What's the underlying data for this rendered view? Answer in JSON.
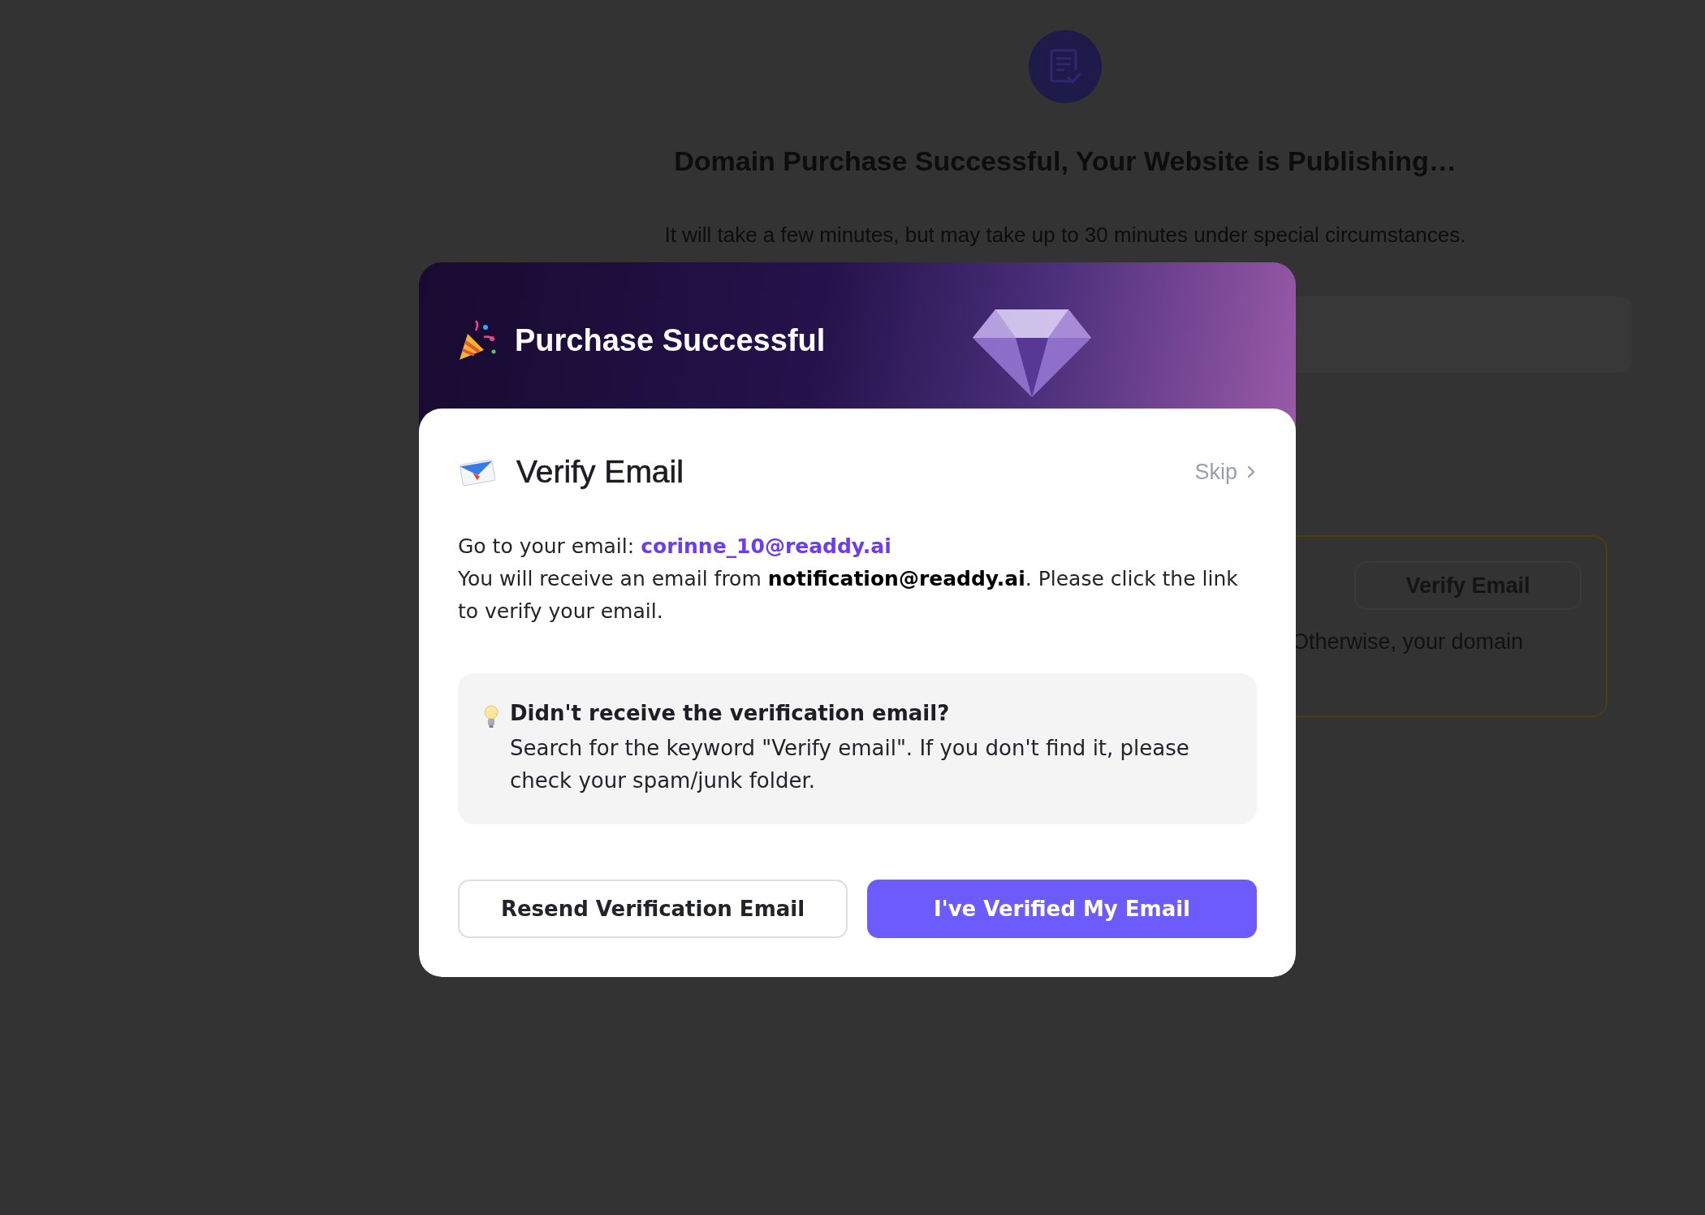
{
  "background_page": {
    "title": "Domain Purchase Successful, Your Website is Publishing…",
    "subtitle": "It will take a few minutes, but may take up to 30 minutes under special circumstances.",
    "notice_card": {
      "button": "Verify Email",
      "text": "Otherwise, your domain"
    }
  },
  "modal": {
    "banner_title": "Purchase Successful",
    "title": "Verify Email",
    "skip": "Skip",
    "intro_label": "Go to your email:",
    "email": "corinne_10@readdy.ai",
    "message": "You will receive an email from **notification@readdy.ai**. Please click the link to verify your email.",
    "tip": {
      "title": "Didn't receive the verification email?",
      "text": "Search for the keyword \"Verify email\". If you don't find it, please check your spam/junk folder."
    },
    "buttons": [
      {
        "label": "Resend Verification Email",
        "kind": "secondary"
      },
      {
        "label": "I've Verified My Email",
        "kind": "primary"
      }
    ]
  }
}
